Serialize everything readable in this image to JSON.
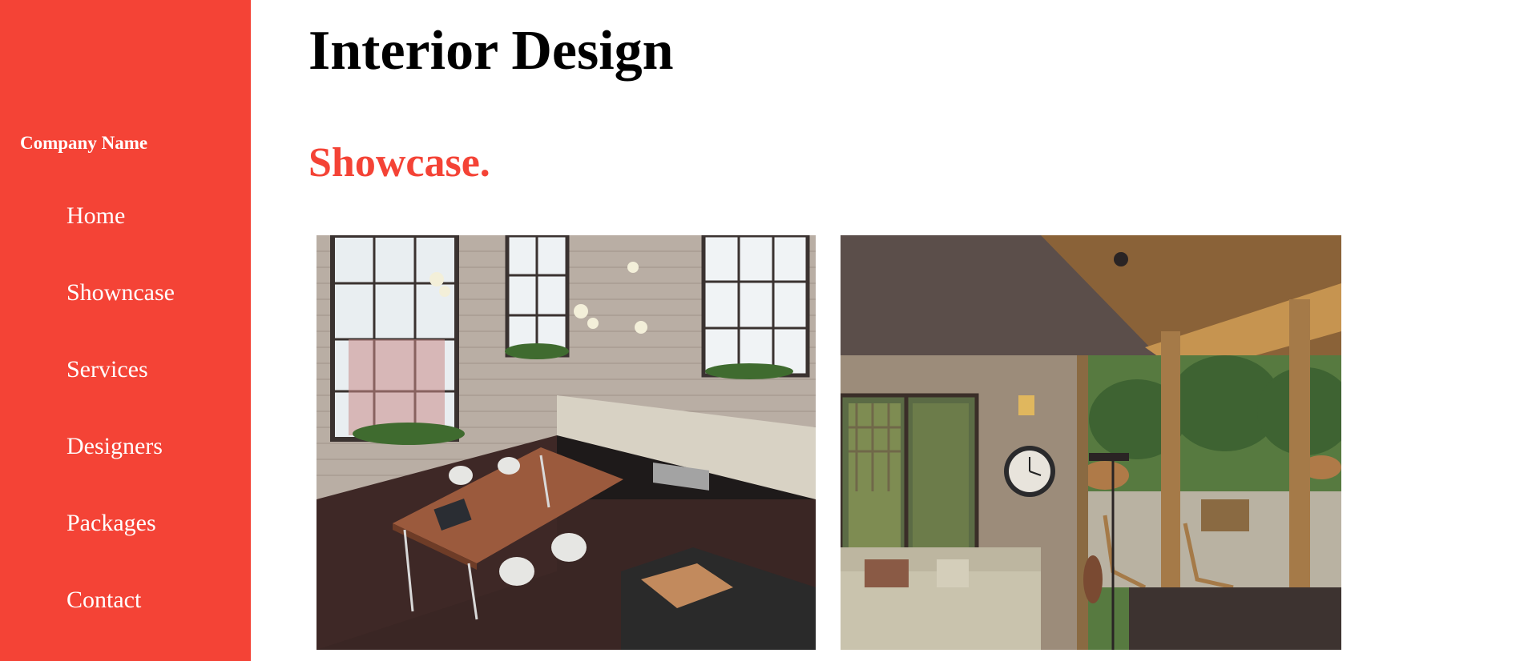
{
  "sidebar": {
    "company_name": "Company Name",
    "nav_items": [
      {
        "label": "Home"
      },
      {
        "label": "Showncase"
      },
      {
        "label": "Services"
      },
      {
        "label": "Designers"
      },
      {
        "label": "Packages"
      },
      {
        "label": "Contact"
      }
    ]
  },
  "main": {
    "title": "Interior Design",
    "section_title": "Showcase.",
    "gallery": [
      {
        "image": "loft-kitchen-photo"
      },
      {
        "image": "living-room-porch-photo"
      }
    ]
  },
  "colors": {
    "accent": "#f44336",
    "sidebar_text": "#ffffff",
    "title_text": "#000000"
  }
}
